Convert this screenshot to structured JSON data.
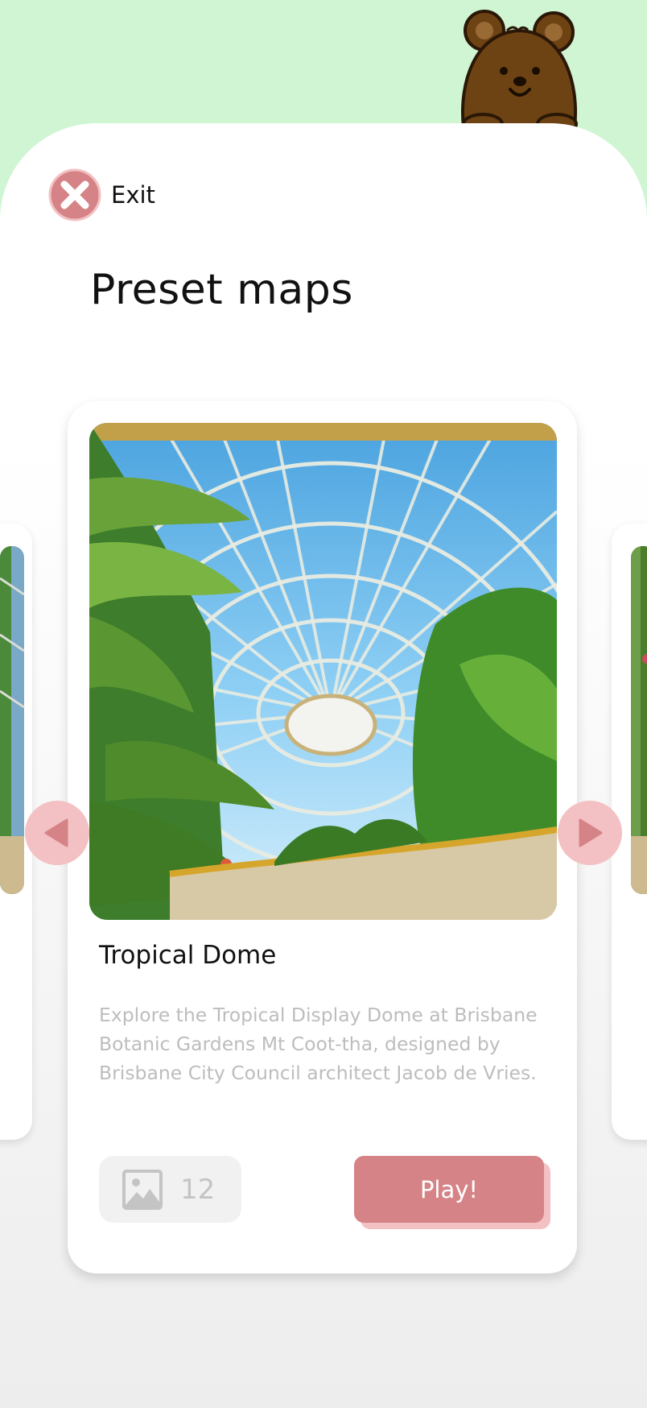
{
  "header": {
    "exit_label": "Exit",
    "title": "Preset maps"
  },
  "card": {
    "name": "Tropical Dome",
    "description": "Explore the Tropical Display Dome at Brisbane Botanic Gardens Mt Coot-tha, designed by Brisbane City Council architect Jacob de Vries.",
    "image_count": "12",
    "play_label": "Play!"
  },
  "icons": {
    "exit": "close-icon",
    "gallery": "image-icon",
    "prev": "chevron-left-icon",
    "next": "chevron-right-icon",
    "mascot": "bear-icon"
  },
  "colors": {
    "background": "#cff5d3",
    "accent": "#d58386",
    "accent_light": "#f3c1c3",
    "bear_brown": "#6e4314"
  }
}
